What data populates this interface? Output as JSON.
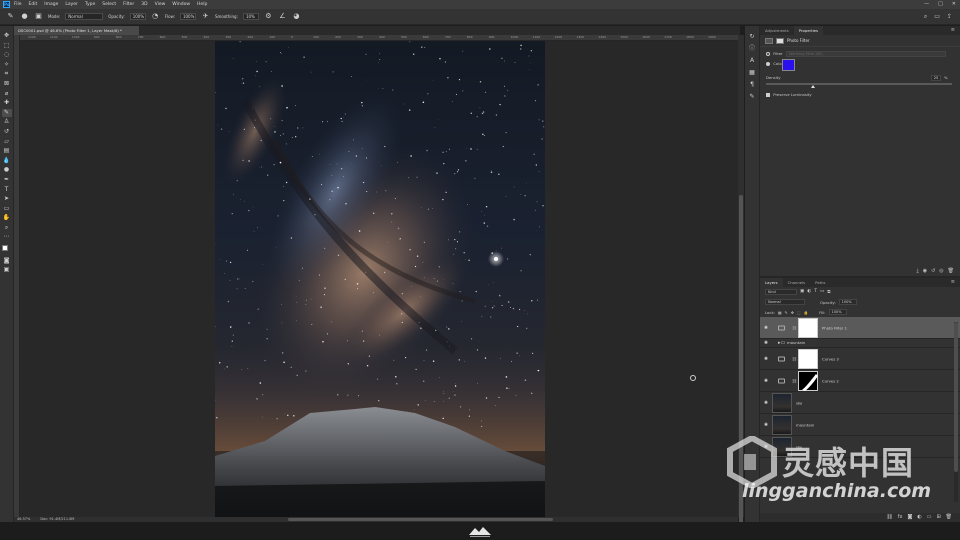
{
  "app": {
    "logo": "Ps",
    "brand_color": "#31a8ff"
  },
  "menu": [
    "File",
    "Edit",
    "Image",
    "Layer",
    "Type",
    "Select",
    "Filter",
    "3D",
    "View",
    "Window",
    "Help"
  ],
  "window_controls": [
    "—",
    "□",
    "✕"
  ],
  "options_bar": {
    "mode_label": "Mode:",
    "mode_value": "Normal",
    "opacity_label": "Opacity:",
    "opacity_value": "100%",
    "flow_label": "Flow:",
    "flow_value": "100%",
    "smoothing_label": "Smoothing:",
    "smoothing_value": "10%"
  },
  "document": {
    "tab_title": "DSC0001.psd @ 46.6% (Photo Filter 1, Layer Mask/8) *",
    "zoom": "46.57%",
    "doc_size": "Doc: 91.4M/211.8M",
    "ruler_ticks": [
      "1200",
      "1100",
      "1000",
      "900",
      "800",
      "700",
      "600",
      "500",
      "400",
      "300",
      "200",
      "100",
      "0",
      "100",
      "200",
      "300",
      "400",
      "500",
      "600",
      "700",
      "800",
      "900",
      "1000",
      "1100",
      "1200",
      "1300",
      "1400",
      "1500",
      "1600",
      "1700",
      "1800",
      "1900"
    ]
  },
  "right_icons": [
    "history-icon",
    "info-icon",
    "character-icon",
    "swatches-icon",
    "paragraph-icon",
    "brush-icon"
  ],
  "properties_panel": {
    "tabs": [
      "Adjustments",
      "Properties"
    ],
    "active_tab": "Properties",
    "header": "Photo Filter",
    "filter_label": "Filter",
    "filter_value": "Warming Filter (85)",
    "color_label": "Color",
    "color_value": "#2b10ee",
    "density_label": "Density",
    "density_value": "25",
    "density_percent": "%",
    "preserve_label": "Preserve Luminosity"
  },
  "layers_panel": {
    "tabs": [
      "Layers",
      "Channels",
      "Paths"
    ],
    "active_tab": "Layers",
    "kind_value": "Kind",
    "blend_value": "Normal",
    "opacity_label": "Opacity:",
    "opacity_value": "100%",
    "lock_label": "Lock:",
    "fill_label": "Fill:",
    "fill_value": "100%",
    "layers": [
      {
        "name": "Photo Filter 1",
        "type": "adjustment",
        "selected": true
      },
      {
        "name": "mountain",
        "type": "group"
      },
      {
        "name": "Curves 3",
        "type": "adjustment"
      },
      {
        "name": "Curves 2",
        "type": "adjustment"
      },
      {
        "name": "sky",
        "type": "pixel"
      },
      {
        "name": "mountain",
        "type": "pixel"
      },
      {
        "name": "sky",
        "type": "pixel"
      }
    ]
  },
  "watermark": {
    "cn": "灵感中国",
    "en": "lingganchina.com"
  }
}
